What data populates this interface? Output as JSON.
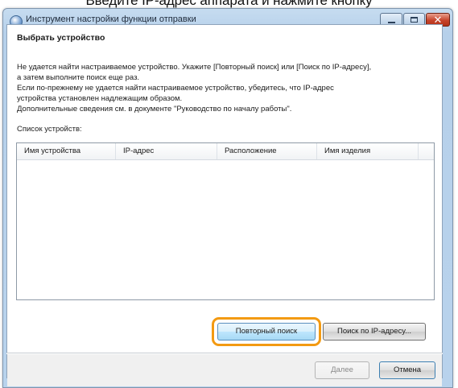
{
  "top_caption": "Введите IP-адрес аппарата и нажмите кнопку",
  "window": {
    "title": "Инструмент настройки функции отправки"
  },
  "title_buttons": {
    "minimize": "",
    "maximize": "",
    "close": "✕"
  },
  "section_title": "Выбрать устройство",
  "message_lines": [
    "Не удается найти настраиваемое устройство. Укажите [Повторный поиск] или [Поиск по IP-адресу],",
    "а затем выполните поиск еще раз.",
    "Если по-прежнему не удается найти настраиваемое устройство, убедитесь, что IP-адрес",
    "устройства установлен надлежащим образом.",
    "Дополнительные сведения см. в документе \"Руководство по началу работы\"."
  ],
  "device_list": {
    "label": "Список устройств:",
    "columns": [
      "Имя устройства",
      "IP-адрес",
      "Расположение",
      "Имя изделия"
    ],
    "rows": []
  },
  "buttons": {
    "retry": "Повторный поиск",
    "ip_search": "Поиск по IP-адресу...",
    "next": "Далее",
    "cancel": "Отмена"
  },
  "colors": {
    "highlight": "#f39a12",
    "titlebar": "#b8d2ec",
    "close_button": "#c7442c"
  }
}
